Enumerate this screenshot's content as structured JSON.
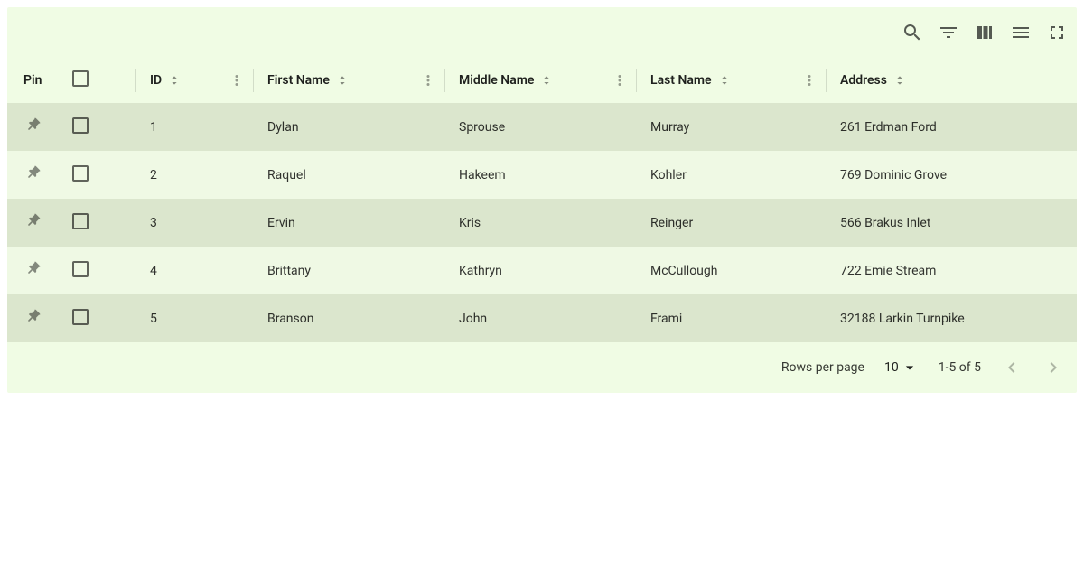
{
  "toolbar": {
    "icons": [
      "search",
      "filter",
      "columns",
      "density",
      "fullscreen"
    ]
  },
  "columns": {
    "pin": {
      "label": "Pin"
    },
    "id": {
      "label": "ID"
    },
    "first": {
      "label": "First Name"
    },
    "middle": {
      "label": "Middle Name"
    },
    "last": {
      "label": "Last Name"
    },
    "addr": {
      "label": "Address"
    }
  },
  "rows": [
    {
      "id": "1",
      "first": "Dylan",
      "middle": "Sprouse",
      "last": "Murray",
      "addr": "261 Erdman Ford"
    },
    {
      "id": "2",
      "first": "Raquel",
      "middle": "Hakeem",
      "last": "Kohler",
      "addr": "769 Dominic Grove"
    },
    {
      "id": "3",
      "first": "Ervin",
      "middle": "Kris",
      "last": "Reinger",
      "addr": "566 Brakus Inlet"
    },
    {
      "id": "4",
      "first": "Brittany",
      "middle": "Kathryn",
      "last": "McCullough",
      "addr": "722 Emie Stream"
    },
    {
      "id": "5",
      "first": "Branson",
      "middle": "John",
      "last": "Frami",
      "addr": "32188 Larkin Turnpike"
    }
  ],
  "pager": {
    "rows_per_page_label": "Rows per page",
    "rows_per_page_value": "10",
    "range": "1-5 of 5"
  }
}
